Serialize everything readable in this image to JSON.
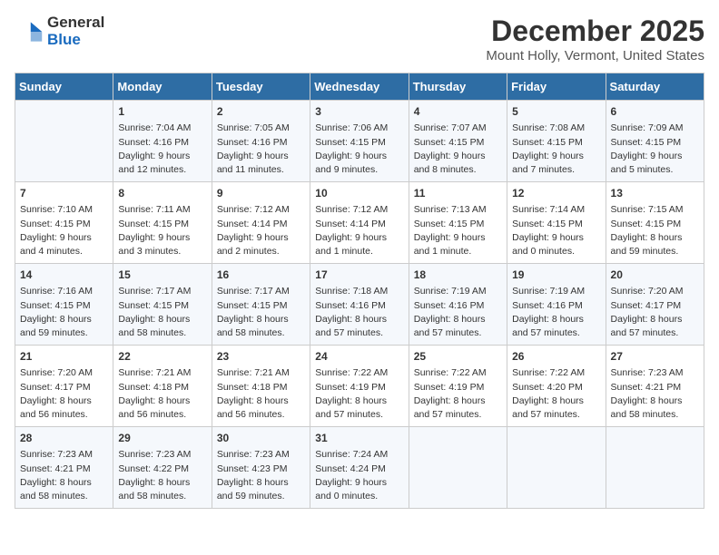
{
  "logo": {
    "general": "General",
    "blue": "Blue"
  },
  "title": "December 2025",
  "subtitle": "Mount Holly, Vermont, United States",
  "days_header": [
    "Sunday",
    "Monday",
    "Tuesday",
    "Wednesday",
    "Thursday",
    "Friday",
    "Saturday"
  ],
  "weeks": [
    [
      {
        "num": "",
        "sunrise": "",
        "sunset": "",
        "daylight": ""
      },
      {
        "num": "1",
        "sunrise": "Sunrise: 7:04 AM",
        "sunset": "Sunset: 4:16 PM",
        "daylight": "Daylight: 9 hours and 12 minutes."
      },
      {
        "num": "2",
        "sunrise": "Sunrise: 7:05 AM",
        "sunset": "Sunset: 4:16 PM",
        "daylight": "Daylight: 9 hours and 11 minutes."
      },
      {
        "num": "3",
        "sunrise": "Sunrise: 7:06 AM",
        "sunset": "Sunset: 4:15 PM",
        "daylight": "Daylight: 9 hours and 9 minutes."
      },
      {
        "num": "4",
        "sunrise": "Sunrise: 7:07 AM",
        "sunset": "Sunset: 4:15 PM",
        "daylight": "Daylight: 9 hours and 8 minutes."
      },
      {
        "num": "5",
        "sunrise": "Sunrise: 7:08 AM",
        "sunset": "Sunset: 4:15 PM",
        "daylight": "Daylight: 9 hours and 7 minutes."
      },
      {
        "num": "6",
        "sunrise": "Sunrise: 7:09 AM",
        "sunset": "Sunset: 4:15 PM",
        "daylight": "Daylight: 9 hours and 5 minutes."
      }
    ],
    [
      {
        "num": "7",
        "sunrise": "Sunrise: 7:10 AM",
        "sunset": "Sunset: 4:15 PM",
        "daylight": "Daylight: 9 hours and 4 minutes."
      },
      {
        "num": "8",
        "sunrise": "Sunrise: 7:11 AM",
        "sunset": "Sunset: 4:15 PM",
        "daylight": "Daylight: 9 hours and 3 minutes."
      },
      {
        "num": "9",
        "sunrise": "Sunrise: 7:12 AM",
        "sunset": "Sunset: 4:14 PM",
        "daylight": "Daylight: 9 hours and 2 minutes."
      },
      {
        "num": "10",
        "sunrise": "Sunrise: 7:12 AM",
        "sunset": "Sunset: 4:14 PM",
        "daylight": "Daylight: 9 hours and 1 minute."
      },
      {
        "num": "11",
        "sunrise": "Sunrise: 7:13 AM",
        "sunset": "Sunset: 4:15 PM",
        "daylight": "Daylight: 9 hours and 1 minute."
      },
      {
        "num": "12",
        "sunrise": "Sunrise: 7:14 AM",
        "sunset": "Sunset: 4:15 PM",
        "daylight": "Daylight: 9 hours and 0 minutes."
      },
      {
        "num": "13",
        "sunrise": "Sunrise: 7:15 AM",
        "sunset": "Sunset: 4:15 PM",
        "daylight": "Daylight: 8 hours and 59 minutes."
      }
    ],
    [
      {
        "num": "14",
        "sunrise": "Sunrise: 7:16 AM",
        "sunset": "Sunset: 4:15 PM",
        "daylight": "Daylight: 8 hours and 59 minutes."
      },
      {
        "num": "15",
        "sunrise": "Sunrise: 7:17 AM",
        "sunset": "Sunset: 4:15 PM",
        "daylight": "Daylight: 8 hours and 58 minutes."
      },
      {
        "num": "16",
        "sunrise": "Sunrise: 7:17 AM",
        "sunset": "Sunset: 4:15 PM",
        "daylight": "Daylight: 8 hours and 58 minutes."
      },
      {
        "num": "17",
        "sunrise": "Sunrise: 7:18 AM",
        "sunset": "Sunset: 4:16 PM",
        "daylight": "Daylight: 8 hours and 57 minutes."
      },
      {
        "num": "18",
        "sunrise": "Sunrise: 7:19 AM",
        "sunset": "Sunset: 4:16 PM",
        "daylight": "Daylight: 8 hours and 57 minutes."
      },
      {
        "num": "19",
        "sunrise": "Sunrise: 7:19 AM",
        "sunset": "Sunset: 4:16 PM",
        "daylight": "Daylight: 8 hours and 57 minutes."
      },
      {
        "num": "20",
        "sunrise": "Sunrise: 7:20 AM",
        "sunset": "Sunset: 4:17 PM",
        "daylight": "Daylight: 8 hours and 57 minutes."
      }
    ],
    [
      {
        "num": "21",
        "sunrise": "Sunrise: 7:20 AM",
        "sunset": "Sunset: 4:17 PM",
        "daylight": "Daylight: 8 hours and 56 minutes."
      },
      {
        "num": "22",
        "sunrise": "Sunrise: 7:21 AM",
        "sunset": "Sunset: 4:18 PM",
        "daylight": "Daylight: 8 hours and 56 minutes."
      },
      {
        "num": "23",
        "sunrise": "Sunrise: 7:21 AM",
        "sunset": "Sunset: 4:18 PM",
        "daylight": "Daylight: 8 hours and 56 minutes."
      },
      {
        "num": "24",
        "sunrise": "Sunrise: 7:22 AM",
        "sunset": "Sunset: 4:19 PM",
        "daylight": "Daylight: 8 hours and 57 minutes."
      },
      {
        "num": "25",
        "sunrise": "Sunrise: 7:22 AM",
        "sunset": "Sunset: 4:19 PM",
        "daylight": "Daylight: 8 hours and 57 minutes."
      },
      {
        "num": "26",
        "sunrise": "Sunrise: 7:22 AM",
        "sunset": "Sunset: 4:20 PM",
        "daylight": "Daylight: 8 hours and 57 minutes."
      },
      {
        "num": "27",
        "sunrise": "Sunrise: 7:23 AM",
        "sunset": "Sunset: 4:21 PM",
        "daylight": "Daylight: 8 hours and 58 minutes."
      }
    ],
    [
      {
        "num": "28",
        "sunrise": "Sunrise: 7:23 AM",
        "sunset": "Sunset: 4:21 PM",
        "daylight": "Daylight: 8 hours and 58 minutes."
      },
      {
        "num": "29",
        "sunrise": "Sunrise: 7:23 AM",
        "sunset": "Sunset: 4:22 PM",
        "daylight": "Daylight: 8 hours and 58 minutes."
      },
      {
        "num": "30",
        "sunrise": "Sunrise: 7:23 AM",
        "sunset": "Sunset: 4:23 PM",
        "daylight": "Daylight: 8 hours and 59 minutes."
      },
      {
        "num": "31",
        "sunrise": "Sunrise: 7:24 AM",
        "sunset": "Sunset: 4:24 PM",
        "daylight": "Daylight: 9 hours and 0 minutes."
      },
      {
        "num": "",
        "sunrise": "",
        "sunset": "",
        "daylight": ""
      },
      {
        "num": "",
        "sunrise": "",
        "sunset": "",
        "daylight": ""
      },
      {
        "num": "",
        "sunrise": "",
        "sunset": "",
        "daylight": ""
      }
    ]
  ]
}
